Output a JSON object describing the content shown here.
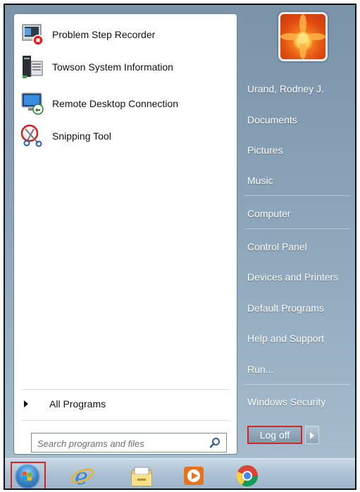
{
  "programs": [
    {
      "label": "Problem Step Recorder",
      "icon": "problem-step-recorder-icon"
    },
    {
      "label": "Towson System Information",
      "icon": "system-information-icon"
    },
    {
      "label": "Remote Desktop Connection",
      "icon": "remote-desktop-icon"
    },
    {
      "label": "Snipping Tool",
      "icon": "snipping-tool-icon"
    }
  ],
  "all_programs": "All Programs",
  "search": {
    "placeholder": "Search programs and files",
    "value": ""
  },
  "right_menu": {
    "user": "Urand, Rodney J.",
    "items": [
      "Documents",
      "Pictures",
      "Music",
      "Computer",
      "Control Panel",
      "Devices and Printers",
      "Default Programs",
      "Help and Support",
      "Run...",
      "Windows Security"
    ]
  },
  "logoff_label": "Log off",
  "taskbar": [
    "start-orb",
    "internet-explorer-icon",
    "file-explorer-icon",
    "media-player-icon",
    "chrome-icon"
  ],
  "colors": {
    "highlight_border": "#d8261f",
    "menu_bg": "#8aa3b8"
  }
}
